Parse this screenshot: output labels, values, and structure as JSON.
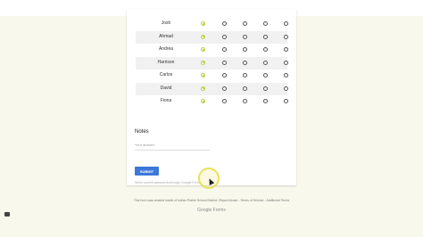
{
  "grid": {
    "rows": [
      {
        "name": "Josh",
        "selected": 0
      },
      {
        "name": "Ahmad",
        "selected": 0
      },
      {
        "name": "Andrea",
        "selected": 0
      },
      {
        "name": "Harrison",
        "selected": 0
      },
      {
        "name": "Carlos",
        "selected": 0
      },
      {
        "name": "David",
        "selected": 0
      },
      {
        "name": "Fiona",
        "selected": 0
      }
    ],
    "columns_count": 5
  },
  "notes": {
    "title": "Notes",
    "placeholder": "Your answer"
  },
  "submit": {
    "label": "SUBMIT"
  },
  "never_submit": "Never submit passwords through Google Forms.",
  "footer": {
    "text": "This form was created inside of Indian Prairie School District. Report Abuse - Terms of Service - Additional Terms",
    "logo": "Google Forms"
  },
  "colors": {
    "accent": "#b6cf3d",
    "button": "#3c78d8"
  }
}
